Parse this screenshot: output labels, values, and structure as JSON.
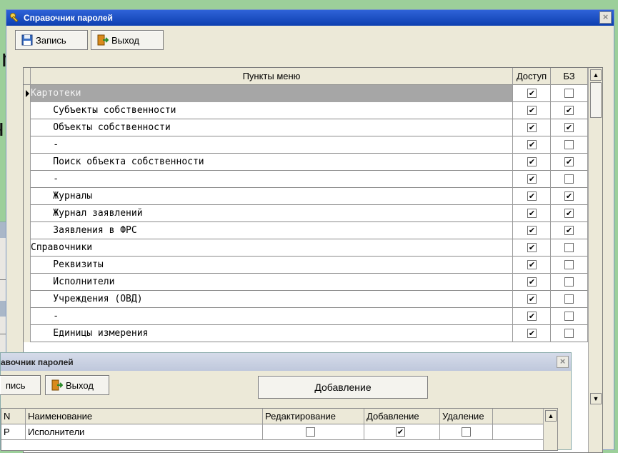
{
  "background": {
    "text_1": "n",
    "text_2": "ч"
  },
  "main_window": {
    "title": "Справочник паролей",
    "close_glyph": "×",
    "toolbar": {
      "save_label": "Запись",
      "exit_label": "Выход"
    },
    "columns": {
      "name": "Пункты меню",
      "access": "Доступ",
      "bz": "БЗ"
    },
    "rows": [
      {
        "name": "Картотеки",
        "access": true,
        "bz": false,
        "selected": true
      },
      {
        "name": "    Субъекты собственности",
        "access": true,
        "bz": true
      },
      {
        "name": "    Объекты собственности",
        "access": true,
        "bz": true
      },
      {
        "name": "    -",
        "access": true,
        "bz": false
      },
      {
        "name": "    Поиск объекта собственности",
        "access": true,
        "bz": true
      },
      {
        "name": "    -",
        "access": true,
        "bz": false
      },
      {
        "name": "    Журналы",
        "access": true,
        "bz": true
      },
      {
        "name": "    Журнал заявлений",
        "access": true,
        "bz": true
      },
      {
        "name": "    Заявления в ФРС",
        "access": true,
        "bz": true
      },
      {
        "name": "Справочники",
        "access": true,
        "bz": false
      },
      {
        "name": "    Реквизиты",
        "access": true,
        "bz": false
      },
      {
        "name": "    Исполнители",
        "access": true,
        "bz": false
      },
      {
        "name": "    Учреждения (ОВД)",
        "access": true,
        "bz": false
      },
      {
        "name": "    -",
        "access": true,
        "bz": false
      },
      {
        "name": "    Единицы измерения",
        "access": true,
        "bz": false
      }
    ]
  },
  "second_window": {
    "title": "авочник паролей",
    "close_glyph": "×",
    "toolbar": {
      "save_label": "пись",
      "exit_label": "Выход",
      "add_label": "Добавление"
    },
    "columns": {
      "n": "N",
      "name": "Наименование",
      "edit": "Редактирование",
      "add": "Добавление",
      "delete": "Удаление"
    },
    "rows": [
      {
        "n": "P",
        "name": "Исполнители",
        "edit": false,
        "add": true,
        "delete": false
      }
    ]
  },
  "colors": {
    "title_blue": "#0d3fb0",
    "selected_row": "#a6a6a6",
    "window_face": "#ece9d8",
    "background": "#9ccf9a"
  }
}
